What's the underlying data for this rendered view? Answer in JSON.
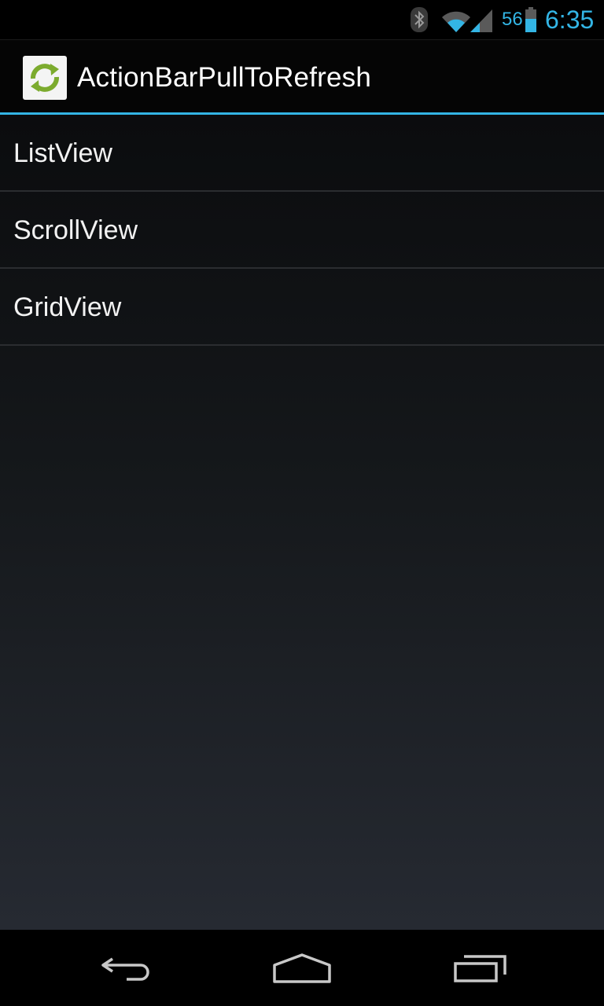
{
  "status_bar": {
    "bluetooth_icon": "bluetooth-icon",
    "wifi_icon": "wifi-icon",
    "signal_icon": "cell-signal-icon",
    "battery_percent": "56",
    "battery_icon": "battery-icon",
    "time": "6:35",
    "accent_color": "#33b5e5"
  },
  "action_bar": {
    "app_icon": "refresh-icon",
    "title": "ActionBarPullToRefresh",
    "divider_color": "#33b5e5"
  },
  "list": {
    "items": [
      {
        "label": "ListView"
      },
      {
        "label": "ScrollView"
      },
      {
        "label": "GridView"
      }
    ]
  },
  "nav_bar": {
    "back_icon": "back-icon",
    "home_icon": "home-icon",
    "recents_icon": "recent-apps-icon"
  }
}
